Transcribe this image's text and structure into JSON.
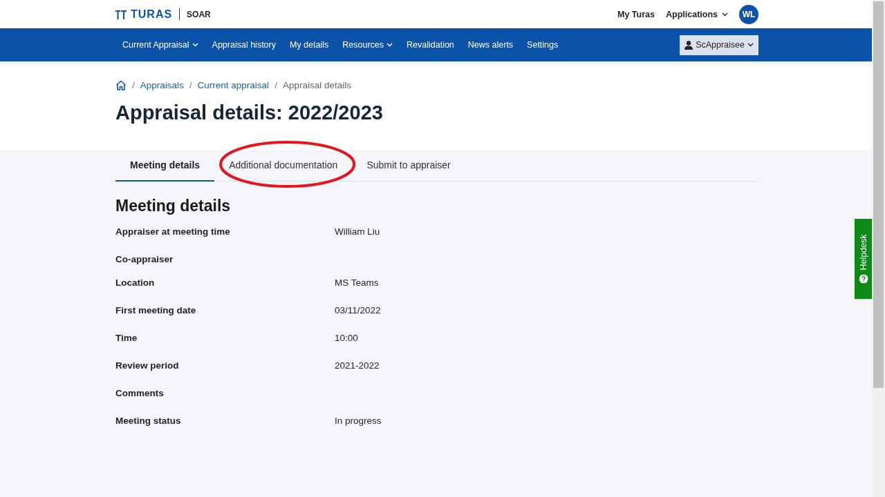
{
  "header": {
    "brand": "TURAS",
    "product": "SOAR",
    "links": [
      {
        "label": "My Turas",
        "dropdown": false
      },
      {
        "label": "Applications",
        "dropdown": true
      }
    ],
    "avatar": "WL"
  },
  "nav": {
    "items": [
      {
        "label": "Current Appraisal",
        "dropdown": true
      },
      {
        "label": "Appraisal history",
        "dropdown": false
      },
      {
        "label": "My details",
        "dropdown": false
      },
      {
        "label": "Resources",
        "dropdown": true
      },
      {
        "label": "Revalidation",
        "dropdown": false
      },
      {
        "label": "News alerts",
        "dropdown": false
      },
      {
        "label": "Settings",
        "dropdown": false
      }
    ],
    "user": "ScAppraisee"
  },
  "breadcrumb_separator": "/",
  "breadcrumb": [
    {
      "label": "Appraisals",
      "link": true
    },
    {
      "label": "Current appraisal",
      "link": true
    },
    {
      "label": "Appraisal details",
      "link": false
    }
  ],
  "title": "Appraisal details: 2022/2023",
  "tabs": [
    {
      "label": "Meeting details",
      "selected": true,
      "circled": false
    },
    {
      "label": "Additional documentation",
      "selected": false,
      "circled": true
    },
    {
      "label": "Submit to appraiser",
      "selected": false,
      "circled": false
    }
  ],
  "section": {
    "heading": "Meeting details",
    "fields": [
      {
        "label": "Appraiser at meeting time",
        "value": "William Liu"
      },
      {
        "label": "Co-appraiser"
      },
      {
        "label": "Location",
        "value": "MS Teams"
      },
      {
        "label": "First meeting date",
        "value": "03/11/2022"
      },
      {
        "label": "Time",
        "value": "10:00"
      },
      {
        "label": "Review period",
        "value": "2021-2022"
      },
      {
        "label": "Comments"
      },
      {
        "label": "Meeting status",
        "value": "In progress"
      }
    ]
  },
  "helpdesk": "Helpdesk"
}
